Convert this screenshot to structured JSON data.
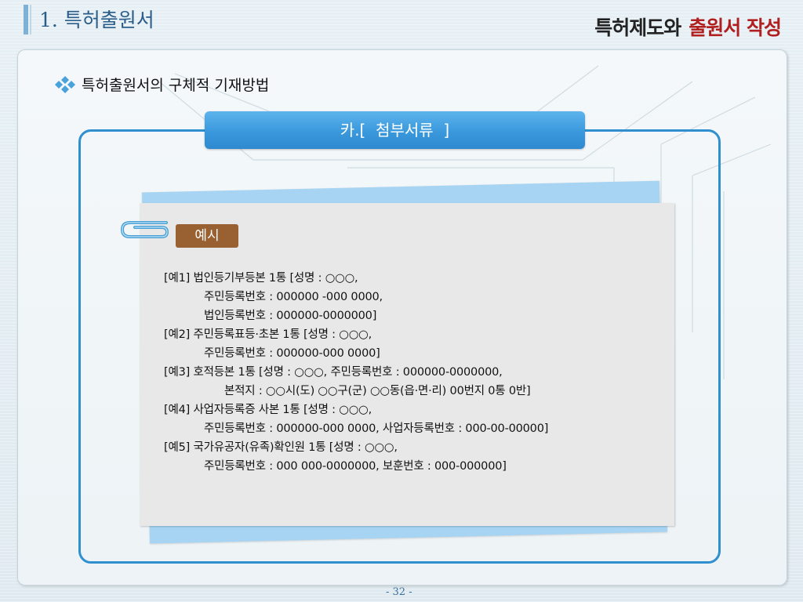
{
  "slide": {
    "title": "1. 특허출원서",
    "brand_part1": "특허제도와",
    "brand_part2": "출원서 작성",
    "subheading": "특허출원서의 구체적 기재방법",
    "section_title": "카.[  첨부서류  ]",
    "page_number": "- 32 -"
  },
  "example": {
    "badge": "예시",
    "lines": [
      "[예1] 법인등기부등본 1통 [성명 : ○○○,",
      "주민등록번호 : 000000 -000 0000,",
      "법인등록번호 : 000000-0000000]",
      "[예2] 주민등록표등·초본 1통 [성명 : ○○○,",
      "주민등록번호 : 000000-000 0000]",
      "[예3] 호적등본 1통 [성명 : ○○○, 주민등록번호 : 000000-0000000,",
      "본적지 : ○○시(도) ○○구(군) ○○동(읍·면·리) 00번지 0통 0반]",
      "[예4] 사업자등록증 사본 1통 [성명 : ○○○,",
      "주민등록번호 : 000000-000 0000, 사업자등록번호 : 000-00-00000]",
      "[예5] 국가유공자(유족)확인원 1통 [성명 : ○○○,",
      "주민등록번호 : 000 000-0000000, 보훈번호 : 000-000000]"
    ]
  },
  "colors": {
    "accent_blue": "#2f8fcf",
    "tab_blue": "#3a98dc",
    "badge_brown": "#996131",
    "brand_red": "#b02020",
    "paper_back_blue": "#a7d4f3"
  },
  "icons": [
    "diamond-cluster-icon",
    "paperclip-icon"
  ]
}
